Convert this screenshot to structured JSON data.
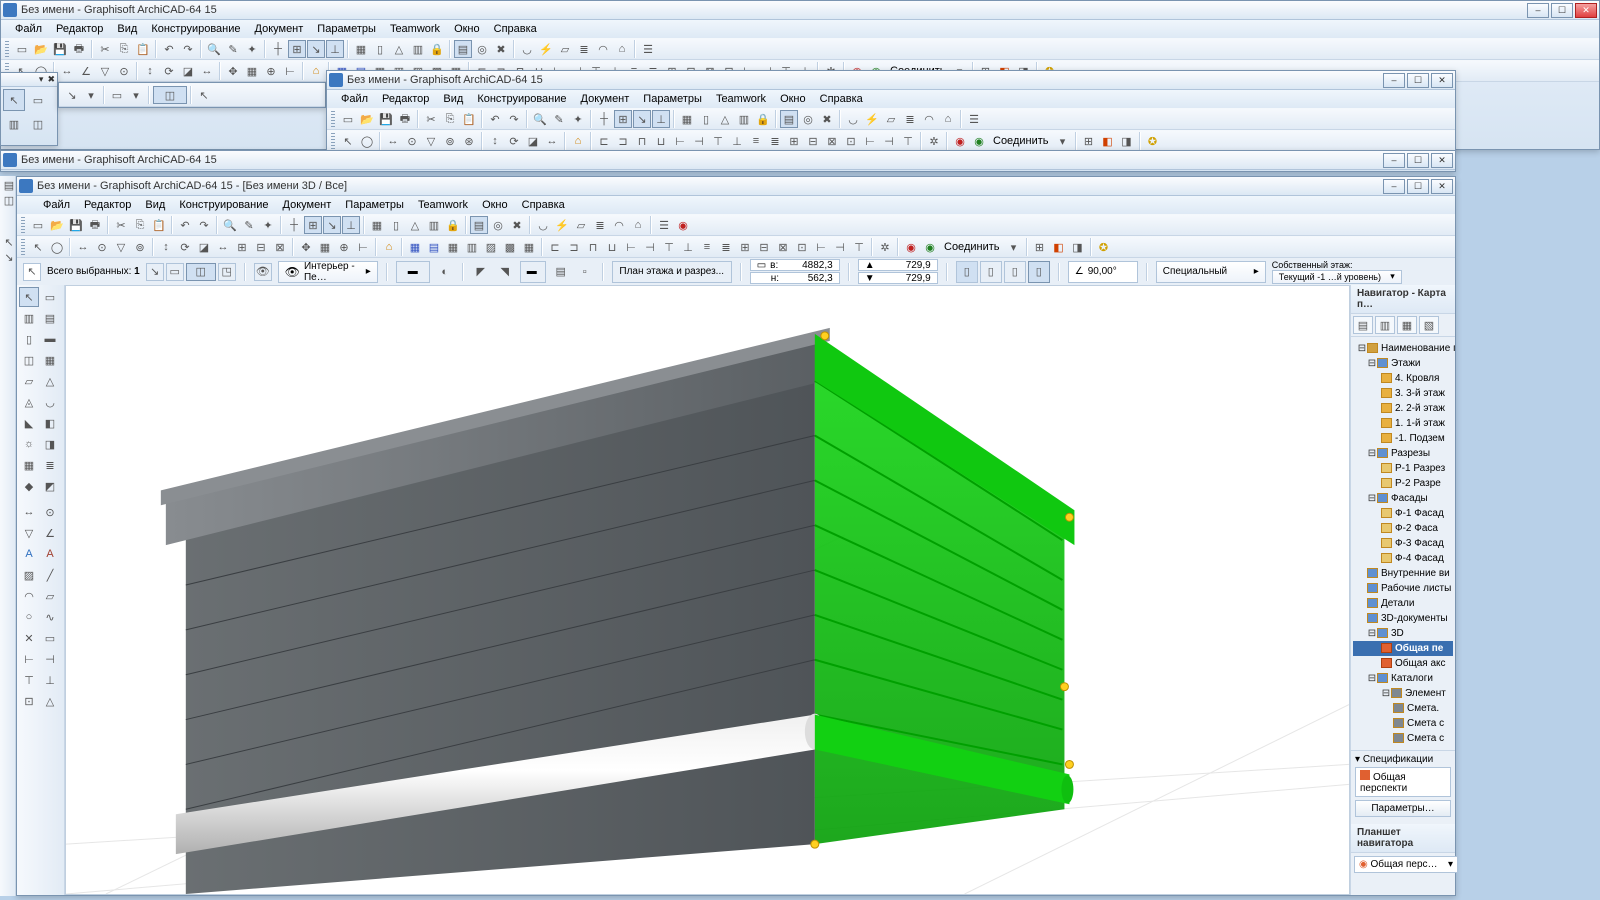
{
  "app_title": "Без имени - Graphisoft ArchiCAD-64 15",
  "child_title": "Без имени - Graphisoft ArchiCAD-64 15 - [Без имени 3D / Все]",
  "menu": [
    "Файл",
    "Редактор",
    "Вид",
    "Конструирование",
    "Документ",
    "Параметры",
    "Teamwork",
    "Окно",
    "Справка"
  ],
  "connect": "Соединить",
  "infobar": {
    "selected_label": "Всего выбранных:",
    "selected_count": "1",
    "view_mode": "Интерьер - Пе…",
    "floor_button": "План этажа и разрез...",
    "coord_a_label": "в:",
    "coord_a": "4882,3",
    "coord_b_label": "н:",
    "coord_b": "562,3",
    "height_a": "729,9",
    "height_b": "729,9",
    "angle_deg": "90,00°",
    "dropdown1": "Специальный",
    "floor_own_label": "Собственный этаж:",
    "floor_own": "Текущий -1 …й уровень)"
  },
  "navigator": {
    "title": "Навигатор - Карта п…",
    "root": "Наименование про",
    "floors_group": "Этажи",
    "floors": [
      "4. Кровля",
      "3. 3-й этаж",
      "2. 2-й этаж",
      "1. 1-й этаж",
      "-1. Подзем"
    ],
    "sections_group": "Разрезы",
    "sections": [
      "Р-1 Разрез",
      "Р-2 Разре"
    ],
    "facades_group": "Фасады",
    "facades": [
      "Ф-1 Фасад",
      "Ф-2 Фаса",
      "Ф-3 Фасад",
      "Ф-4 Фасад"
    ],
    "interior": "Внутренние ви",
    "worksheets": "Рабочие листы",
    "details": "Детали",
    "docs3d": "3D-документы",
    "node3d": "3D",
    "persp_sel": "Общая пе",
    "axo": "Общая акс",
    "catalogs": "Каталоги",
    "element": "Элемент",
    "smeta": [
      "Смета.",
      "Смета с",
      "Смета с"
    ]
  },
  "spec": {
    "title": "Спецификации",
    "drop": "Общая перспекти",
    "btn": "Параметры…"
  },
  "navset": {
    "title": "Планшет навигатора",
    "drop": "Общая перс…"
  }
}
